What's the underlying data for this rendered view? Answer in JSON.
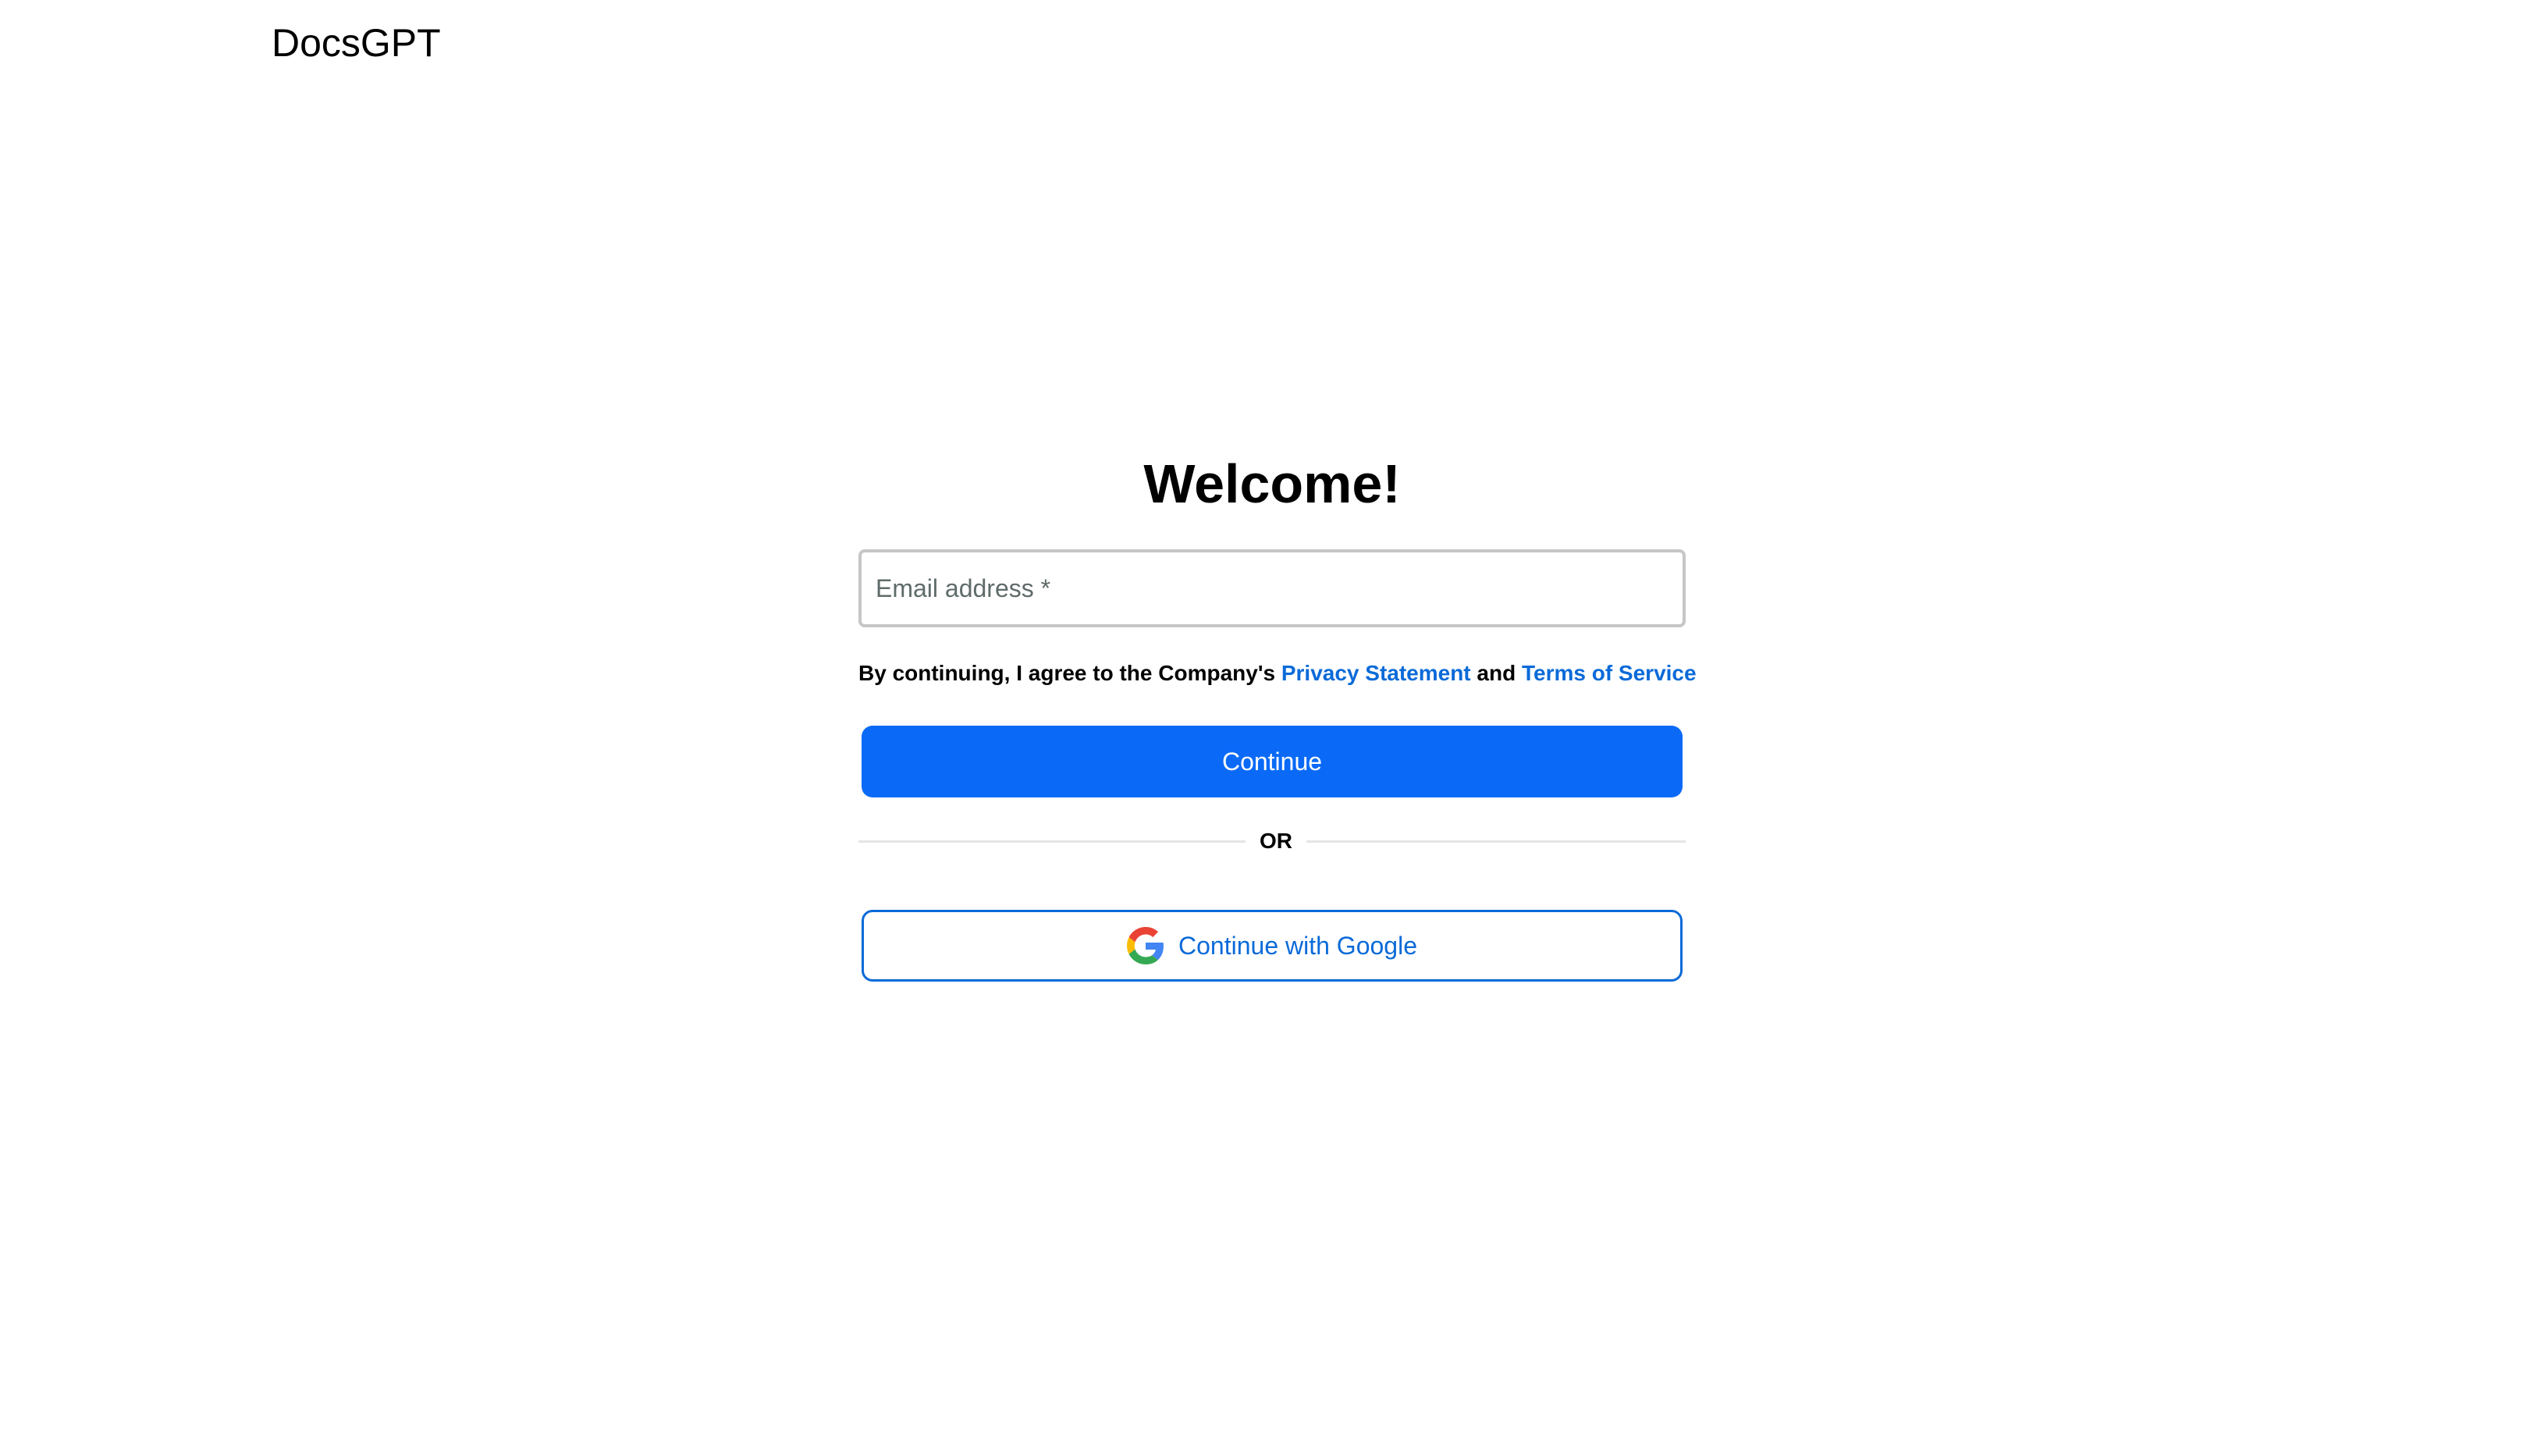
{
  "header": {
    "brand": "DocsGPT"
  },
  "login": {
    "title": "Welcome!",
    "email_placeholder": "Email address *",
    "terms_prefix": "By continuing, I agree to the Company's",
    "privacy_link": "Privacy Statement",
    "terms_and": "and",
    "terms_link": "Terms of Service",
    "continue_label": "Continue",
    "divider_label": "OR",
    "google_label": "Continue with Google",
    "google_icon": "google-icon"
  },
  "colors": {
    "primary": "#0a6af7",
    "link": "#0a6ad8",
    "border": "#c6c6c6",
    "divider": "#e5e5e5"
  }
}
